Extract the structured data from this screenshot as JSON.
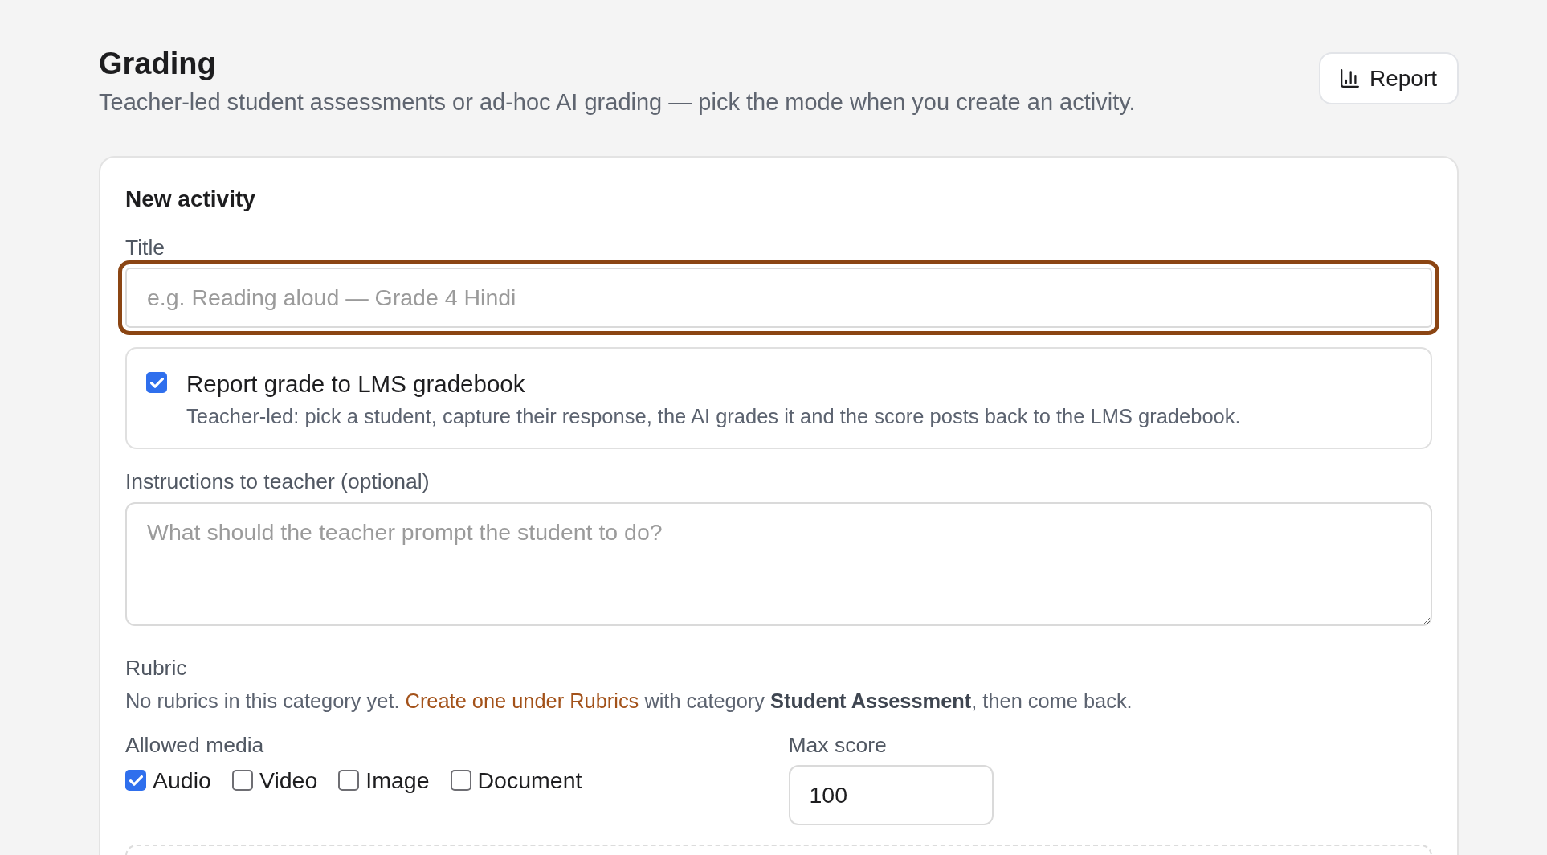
{
  "header": {
    "title": "Grading",
    "subtitle": "Teacher-led student assessments or ad-hoc AI grading — pick the mode when you create an activity.",
    "report_button": "Report"
  },
  "new_activity": {
    "heading": "New activity",
    "title_field": {
      "label": "Title",
      "placeholder": "e.g. Reading aloud — Grade 4 Hindi",
      "focused": true
    },
    "report_grade": {
      "label": "Report grade to LMS gradebook",
      "description": "Teacher-led: pick a student, capture their response, the AI grades it and the score posts back to the LMS gradebook.",
      "checked": true
    },
    "instructions_field": {
      "label": "Instructions to teacher (optional)",
      "placeholder": "What should the teacher prompt the student to do?"
    },
    "rubric": {
      "label": "Rubric",
      "text_before": "No rubrics in this category yet.",
      "link": "Create one under Rubrics",
      "text_after": "with category **Student Assessment**, then come back."
    },
    "allowed_media": {
      "label": "Allowed media",
      "options": [
        {
          "label": "Audio",
          "checked": true
        },
        {
          "label": "Video",
          "checked": false
        },
        {
          "label": "Image",
          "checked": false
        },
        {
          "label": "Document",
          "checked": false
        }
      ]
    },
    "max_score": {
      "label": "Max score",
      "value": "100"
    }
  }
}
